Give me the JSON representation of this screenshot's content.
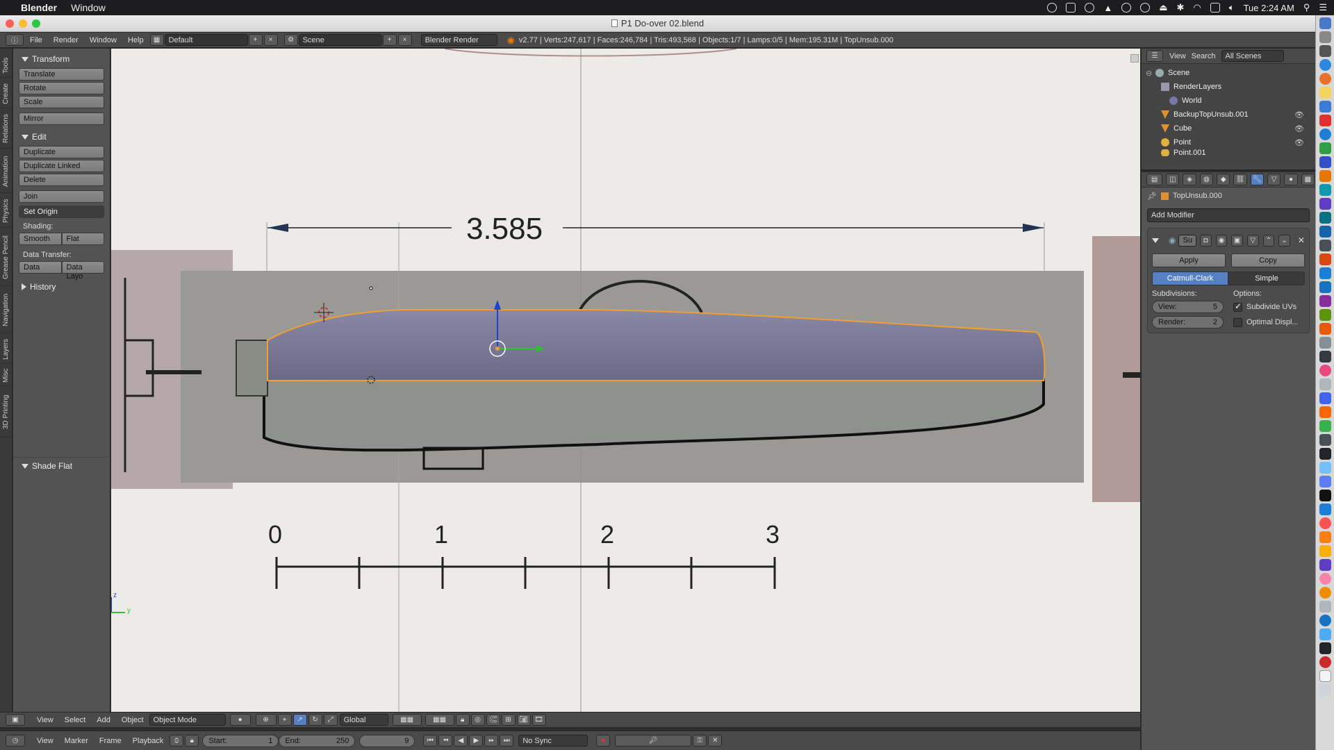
{
  "menubar": {
    "app": "Blender",
    "items": [
      "Window"
    ],
    "clock": "Tue 2:24 AM"
  },
  "window": {
    "title": "P1 Do-over 02.blend"
  },
  "header": {
    "menus": [
      "File",
      "Render",
      "Window",
      "Help"
    ],
    "layout": "Default",
    "scene": "Scene",
    "engine": "Blender Render",
    "stats": "v2.77 | Verts:247,617 | Faces:246,784 | Tris:493,568 | Objects:1/7 | Lamps:0/5 | Mem:195.31M | TopUnsub.000"
  },
  "vtabs": [
    "Tools",
    "Create",
    "Relations",
    "Animation",
    "Physics",
    "Grease Pencil",
    "Navigation",
    "Layers",
    "Misc",
    "3D Printing"
  ],
  "toolshelf": {
    "transform_title": "Transform",
    "translate": "Translate",
    "rotate": "Rotate",
    "scale": "Scale",
    "mirror": "Mirror",
    "edit_title": "Edit",
    "duplicate": "Duplicate",
    "duplicate_linked": "Duplicate Linked",
    "delete": "Delete",
    "join": "Join",
    "set_origin": "Set Origin",
    "shading_label": "Shading:",
    "smooth": "Smooth",
    "flat": "Flat",
    "data_transfer_label": "Data Transfer:",
    "data": "Data",
    "data_layo": "Data Layo",
    "history_title": "History",
    "shade_flat_title": "Shade Flat"
  },
  "viewport": {
    "dimension": "3.585",
    "ruler": [
      "0",
      "1",
      "2",
      "3"
    ],
    "axis_z": "z",
    "axis_y": "y"
  },
  "outliner": {
    "view": "View",
    "search": "Search",
    "filter": "All Scenes",
    "items": [
      "Scene",
      "RenderLayers",
      "World",
      "BackupTopUnsub.001",
      "Cube",
      "Point",
      "Point.001"
    ]
  },
  "properties": {
    "object": "TopUnsub.000",
    "add_modifier": "Add Modifier",
    "mod_name": "Su",
    "apply": "Apply",
    "copy": "Copy",
    "catmull": "Catmull-Clark",
    "simple": "Simple",
    "subdivisions": "Subdivisions:",
    "options": "Options:",
    "view_label": "View:",
    "view_val": "5",
    "render_label": "Render:",
    "render_val": "2",
    "subdivide_uvs": "Subdivide UVs",
    "optimal_display": "Optimal Displ..."
  },
  "view3d_header": {
    "menus": [
      "View",
      "Select",
      "Add",
      "Object"
    ],
    "mode": "Object Mode",
    "orientation": "Global"
  },
  "timeline": {
    "menus": [
      "View",
      "Marker",
      "Frame",
      "Playback"
    ],
    "start_label": "Start:",
    "start": "1",
    "end_label": "End:",
    "end": "250",
    "current": "9",
    "sync": "No Sync"
  }
}
